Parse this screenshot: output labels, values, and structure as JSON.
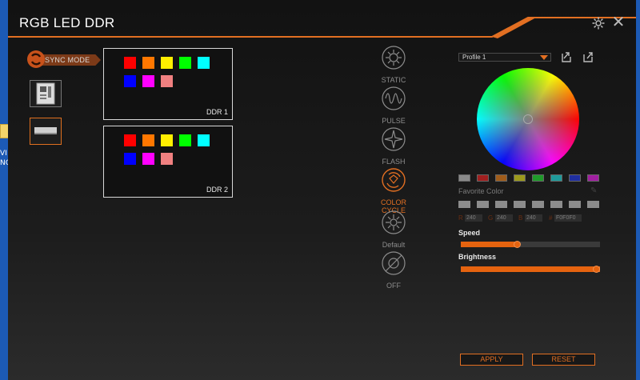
{
  "window": {
    "title": "RGB LED DDR"
  },
  "desktop": {
    "labels": [
      "VI",
      "NG"
    ]
  },
  "sidebar": {
    "sync_label": "SYNC MODE"
  },
  "zones": [
    {
      "label": "DDR 1",
      "colors": [
        "#ff0000",
        "#ff7700",
        "#ffee00",
        "#00ff00",
        "#00ffff",
        "#0000ff",
        "#ff00ff",
        "#f08080"
      ]
    },
    {
      "label": "DDR 2",
      "colors": [
        "#ff0000",
        "#ff7700",
        "#ffee00",
        "#00ff00",
        "#00ffff",
        "#0000ff",
        "#ff00ff",
        "#f08080"
      ]
    }
  ],
  "effects": [
    {
      "label": "STATIC",
      "icon": "sun-icon",
      "active": false
    },
    {
      "label": "PULSE",
      "icon": "pulse-wave-icon",
      "active": false
    },
    {
      "label": "FLASH",
      "icon": "flash-star-icon",
      "active": false
    },
    {
      "label": "COLOR CYCLE",
      "icon": "color-cycle-icon",
      "active": true
    },
    {
      "label": "Default",
      "icon": "default-sun-icon",
      "active": false
    },
    {
      "label": "OFF",
      "icon": "off-icon",
      "active": false
    }
  ],
  "profile": {
    "selected": "Profile 1"
  },
  "favorites": {
    "label": "Favorite Color",
    "colors": [
      "#8a8a8a",
      "#a01f1f",
      "#a05c1a",
      "#9c9a1c",
      "#1f9a2a",
      "#1f9a9a",
      "#1f2ea0",
      "#a01fa0"
    ]
  },
  "rgb": {
    "r_label": "R",
    "r": "240",
    "g_label": "G",
    "g": "240",
    "b_label": "B",
    "b": "240",
    "hex_label": "#",
    "hex": "F0F0F0"
  },
  "speed": {
    "label": "Speed",
    "value": 0.4
  },
  "brightness": {
    "label": "Brightness",
    "value": 1.0
  },
  "actions": {
    "apply": "APPLY",
    "reset": "RESET"
  },
  "colors": {
    "accent": "#e26f22"
  }
}
